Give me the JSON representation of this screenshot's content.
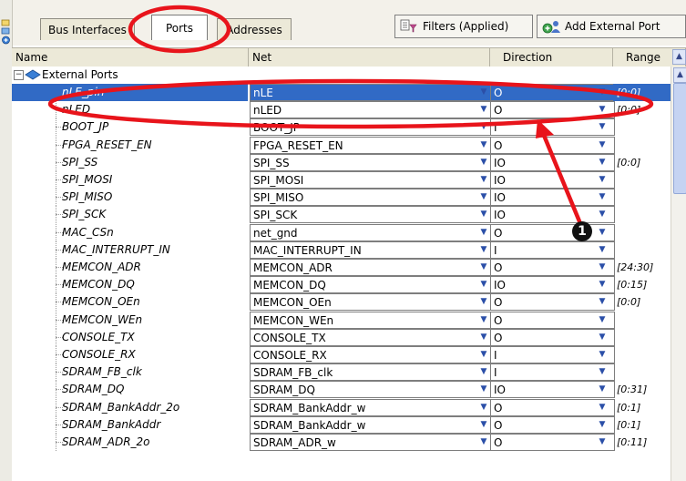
{
  "tabs": [
    {
      "label": "Bus Interfaces",
      "active": false
    },
    {
      "label": "Ports",
      "active": true
    },
    {
      "label": "Addresses",
      "active": false
    }
  ],
  "toolbar": {
    "filters_label": "Filters (Applied)",
    "add_port_label": "Add External Port"
  },
  "columns": {
    "name": "Name",
    "net": "Net",
    "direction": "Direction",
    "range": "Range"
  },
  "group": {
    "label": "External Ports"
  },
  "rows": [
    {
      "name": "nLE_pin",
      "net": "nLE",
      "direction": "O",
      "range": "[0:0]",
      "selected": true
    },
    {
      "name": "nLED",
      "net": "nLED",
      "direction": "O",
      "range": "[0:0]"
    },
    {
      "name": "BOOT_JP",
      "net": "BOOT_JP",
      "direction": "I",
      "range": ""
    },
    {
      "name": "FPGA_RESET_EN",
      "net": "FPGA_RESET_EN",
      "direction": "O",
      "range": ""
    },
    {
      "name": "SPI_SS",
      "net": "SPI_SS",
      "direction": "IO",
      "range": "[0:0]"
    },
    {
      "name": "SPI_MOSI",
      "net": "SPI_MOSI",
      "direction": "IO",
      "range": ""
    },
    {
      "name": "SPI_MISO",
      "net": "SPI_MISO",
      "direction": "IO",
      "range": ""
    },
    {
      "name": "SPI_SCK",
      "net": "SPI_SCK",
      "direction": "IO",
      "range": ""
    },
    {
      "name": "MAC_CSn",
      "net": "net_gnd",
      "direction": "O",
      "range": ""
    },
    {
      "name": "MAC_INTERRUPT_IN",
      "net": "MAC_INTERRUPT_IN",
      "direction": "I",
      "range": ""
    },
    {
      "name": "MEMCON_ADR",
      "net": "MEMCON_ADR",
      "direction": "O",
      "range": "[24:30]"
    },
    {
      "name": "MEMCON_DQ",
      "net": "MEMCON_DQ",
      "direction": "IO",
      "range": "[0:15]"
    },
    {
      "name": "MEMCON_OEn",
      "net": "MEMCON_OEn",
      "direction": "O",
      "range": "[0:0]"
    },
    {
      "name": "MEMCON_WEn",
      "net": "MEMCON_WEn",
      "direction": "O",
      "range": ""
    },
    {
      "name": "CONSOLE_TX",
      "net": "CONSOLE_TX",
      "direction": "O",
      "range": ""
    },
    {
      "name": "CONSOLE_RX",
      "net": "CONSOLE_RX",
      "direction": "I",
      "range": ""
    },
    {
      "name": "SDRAM_FB_clk",
      "net": "SDRAM_FB_clk",
      "direction": "I",
      "range": ""
    },
    {
      "name": "SDRAM_DQ",
      "net": "SDRAM_DQ",
      "direction": "IO",
      "range": "[0:31]"
    },
    {
      "name": "SDRAM_BankAddr_2o",
      "net": "SDRAM_BankAddr_w",
      "direction": "O",
      "range": "[0:1]"
    },
    {
      "name": "SDRAM_BankAddr",
      "net": "SDRAM_BankAddr_w",
      "direction": "O",
      "range": "[0:1]"
    },
    {
      "name": "SDRAM_ADR_2o",
      "net": "SDRAM_ADR_w",
      "direction": "O",
      "range": "[0:11]"
    }
  ],
  "annotation": {
    "marker": "1",
    "color": "#e8141b"
  },
  "colors": {
    "selection": "#316ac5",
    "header_bg": "#ece9d8"
  }
}
